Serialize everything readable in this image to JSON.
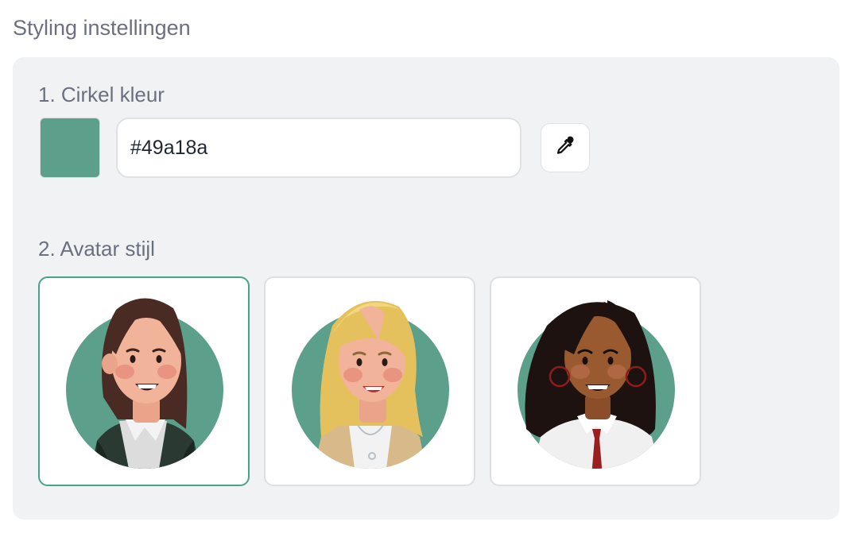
{
  "section": {
    "title": "Styling instellingen"
  },
  "circle_color": {
    "label": "1. Cirkel kleur",
    "value": "#49a18a",
    "swatch_color": "#5c9f8b",
    "picker_icon": "eyedropper-icon"
  },
  "avatar_style": {
    "label": "2. Avatar stijl",
    "selected_index": 0,
    "options": [
      {
        "name": "brunette-woman-blazer",
        "selected": true
      },
      {
        "name": "blonde-woman-beige-jacket",
        "selected": false
      },
      {
        "name": "dark-skin-woman-red-tie",
        "selected": false
      }
    ]
  },
  "colors": {
    "accent": "#49a18a",
    "panel_bg": "#f1f2f4",
    "circle_bg": "#5c9f8b"
  }
}
